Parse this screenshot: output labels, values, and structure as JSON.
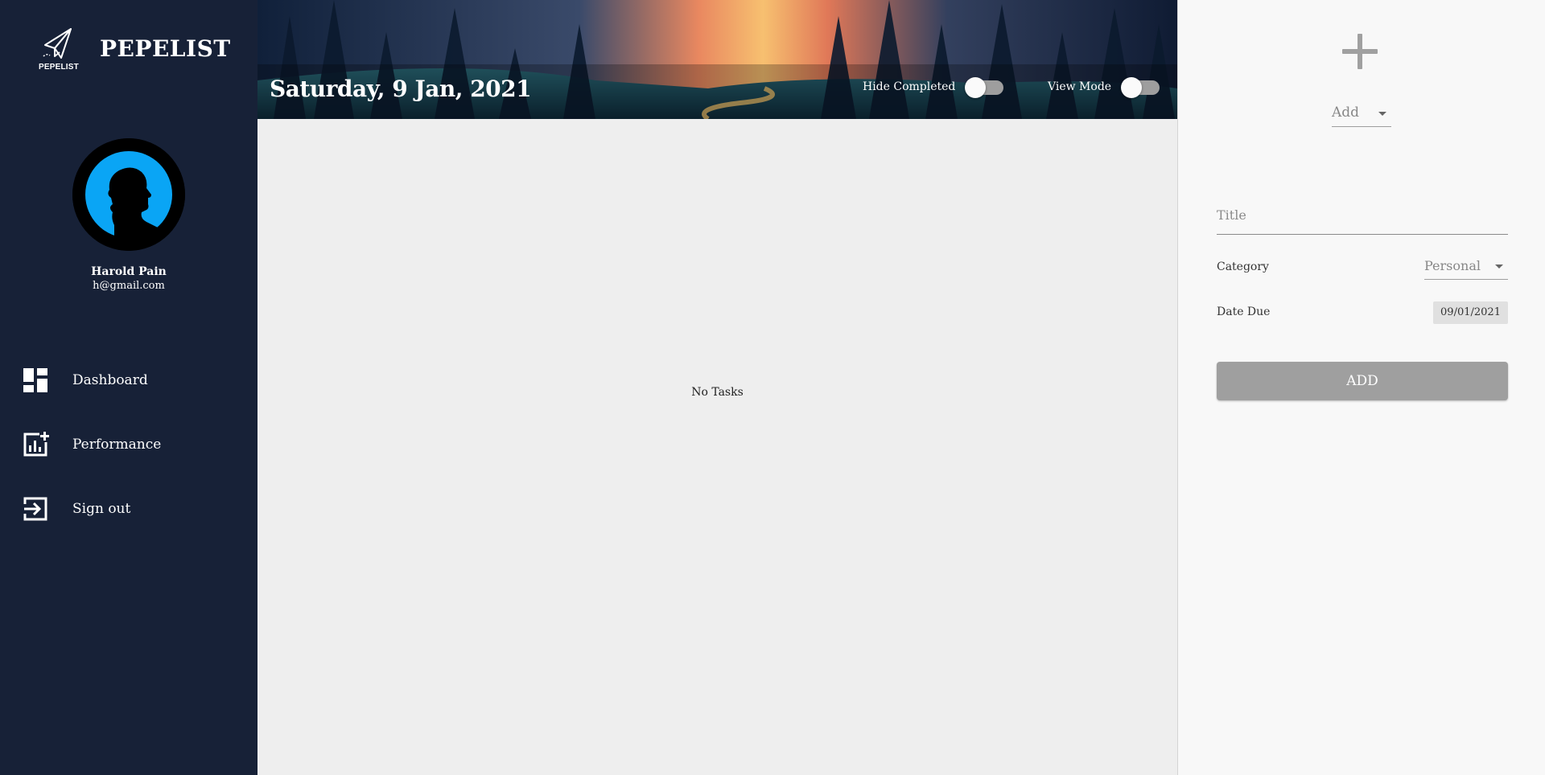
{
  "sidebar": {
    "brand_logo_text": "PEPELIST",
    "brand_name": "PEPELIST",
    "user": {
      "name": "Harold Pain",
      "email": "h@gmail.com"
    },
    "nav": [
      {
        "label": "Dashboard",
        "icon": "dashboard-icon"
      },
      {
        "label": "Performance",
        "icon": "add-chart-icon"
      },
      {
        "label": "Sign out",
        "icon": "sign-out-icon"
      }
    ]
  },
  "header": {
    "date": "Saturday, 9 Jan, 2021",
    "hide_completed_label": "Hide Completed",
    "hide_completed_on": false,
    "view_mode_label": "View Mode",
    "view_mode_on": false
  },
  "main": {
    "empty_text": "No Tasks"
  },
  "panel": {
    "mode_select": "Add",
    "title_placeholder": "Title",
    "category_label": "Category",
    "category_value": "Personal",
    "date_due_label": "Date Due",
    "date_due_value": "09/01/2021",
    "add_button_label": "ADD"
  },
  "colors": {
    "sidebar_bg": "#172137",
    "main_bg": "#eeeeee",
    "panel_bg": "#f8f8f8",
    "avatar_accent": "#0aa5f5",
    "button_bg": "#9f9f9f"
  }
}
